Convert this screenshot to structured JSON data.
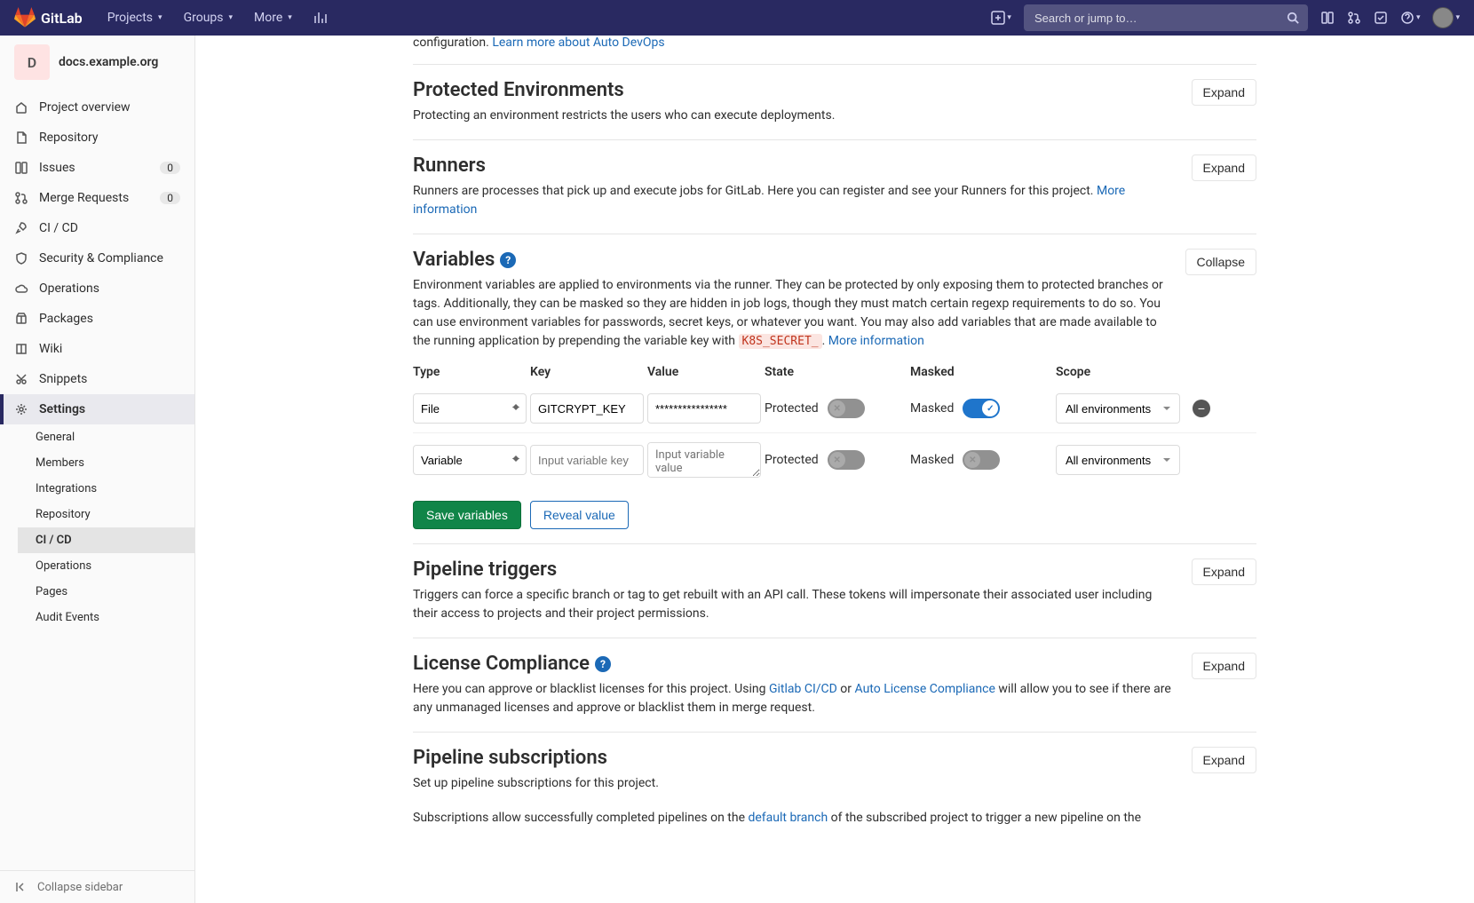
{
  "brand": "GitLab",
  "topnav": {
    "projects": "Projects",
    "groups": "Groups",
    "more": "More"
  },
  "search": {
    "placeholder": "Search or jump to…"
  },
  "project": {
    "initial": "D",
    "name": "docs.example.org"
  },
  "sidenav": {
    "overview": "Project overview",
    "repository": "Repository",
    "issues": "Issues",
    "issues_count": "0",
    "mrs": "Merge Requests",
    "mrs_count": "0",
    "cicd": "CI / CD",
    "security": "Security & Compliance",
    "operations": "Operations",
    "packages": "Packages",
    "wiki": "Wiki",
    "snippets": "Snippets",
    "settings": "Settings"
  },
  "subnav": {
    "general": "General",
    "members": "Members",
    "integrations": "Integrations",
    "repository": "Repository",
    "cicd": "CI / CD",
    "operations": "Operations",
    "pages": "Pages",
    "audit": "Audit Events"
  },
  "collapse": "Collapse sidebar",
  "partial": {
    "text": "configuration. ",
    "link": "Learn more about Auto DevOps"
  },
  "sections": {
    "protected": {
      "title": "Protected Environments",
      "desc": "Protecting an environment restricts the users who can execute deployments.",
      "button": "Expand"
    },
    "runners": {
      "title": "Runners",
      "desc": "Runners are processes that pick up and execute jobs for GitLab. Here you can register and see your Runners for this project. ",
      "link": "More information",
      "button": "Expand"
    },
    "variables": {
      "title": "Variables",
      "desc1": "Environment variables are applied to environments via the runner. They can be protected by only exposing them to protected branches or tags. Additionally, they can be masked so they are hidden in job logs, though they must match certain regexp requirements to do so. You can use environment variables for passwords, secret keys, or whatever you want. You may also add variables that are made available to the running application by prepending the variable key with ",
      "code": "K8S_SECRET_",
      "desc2": ". ",
      "link": "More information",
      "button": "Collapse",
      "headers": {
        "type": "Type",
        "key": "Key",
        "value": "Value",
        "state": "State",
        "masked": "Masked",
        "scope": "Scope"
      },
      "row1": {
        "type": "File",
        "key": "GITCRYPT_KEY",
        "value": "****************",
        "state_label": "Protected",
        "masked_label": "Masked",
        "scope": "All environments"
      },
      "row2": {
        "type": "Variable",
        "key_placeholder": "Input variable key",
        "value_placeholder": "Input variable value",
        "state_label": "Protected",
        "masked_label": "Masked",
        "scope": "All environments"
      },
      "save": "Save variables",
      "reveal": "Reveal value"
    },
    "triggers": {
      "title": "Pipeline triggers",
      "desc": "Triggers can force a specific branch or tag to get rebuilt with an API call. These tokens will impersonate their associated user including their access to projects and their project permissions.",
      "button": "Expand"
    },
    "license": {
      "title": "License Compliance",
      "desc1": "Here you can approve or blacklist licenses for this project. Using ",
      "link1": "Gitlab CI/CD",
      "mid": " or ",
      "link2": "Auto License Compliance",
      "desc2": " will allow you to see if there are any unmanaged licenses and approve or blacklist them in merge request.",
      "button": "Expand"
    },
    "subs": {
      "title": "Pipeline subscriptions",
      "desc": "Set up pipeline subscriptions for this project.",
      "desc2a": "Subscriptions allow successfully completed pipelines on the ",
      "link": "default branch",
      "desc2b": " of the subscribed project to trigger a new pipeline on the",
      "button": "Expand"
    }
  }
}
